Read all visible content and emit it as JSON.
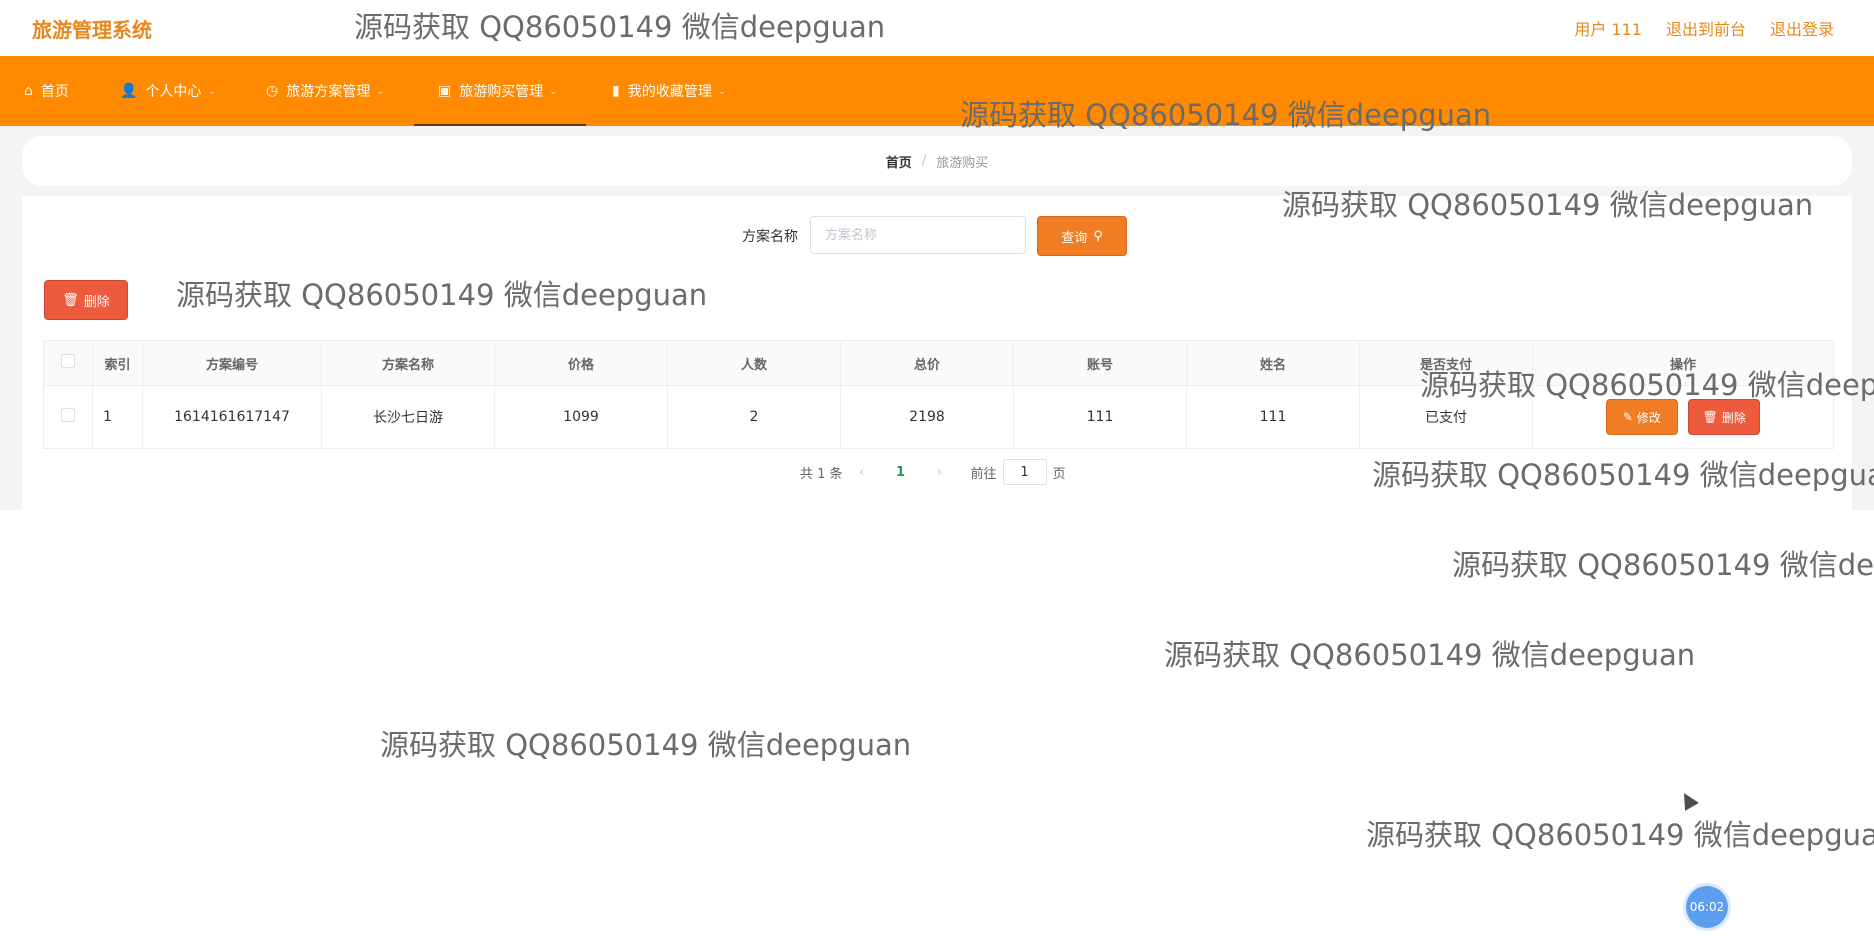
{
  "header": {
    "brand": "旅游管理系统",
    "user_label": "用户 111",
    "front_label": "退出到前台",
    "logout_label": "退出登录"
  },
  "nav": {
    "items": [
      {
        "label": "首页",
        "icon": "home-icon",
        "has_dropdown": false
      },
      {
        "label": "个人中心",
        "icon": "user-icon",
        "has_dropdown": true
      },
      {
        "label": "旅游方案管理",
        "icon": "clock-icon",
        "has_dropdown": true
      },
      {
        "label": "旅游购买管理",
        "icon": "shop-icon",
        "has_dropdown": true,
        "active": true
      },
      {
        "label": "我的收藏管理",
        "icon": "chart-icon",
        "has_dropdown": true
      }
    ]
  },
  "breadcrumb": {
    "home": "首页",
    "sep": "/",
    "current": "旅游购买"
  },
  "search": {
    "label": "方案名称",
    "placeholder": "方案名称",
    "value": "",
    "button_label": "查询"
  },
  "actions": {
    "delete_label": "删除"
  },
  "table": {
    "columns": [
      "索引",
      "方案编号",
      "方案名称",
      "价格",
      "人数",
      "总价",
      "账号",
      "姓名",
      "是否支付",
      "操作"
    ],
    "rows": [
      {
        "index": "1",
        "code": "1614161617147",
        "name": "长沙七日游",
        "price": "1099",
        "people": "2",
        "total": "2198",
        "account": "111",
        "realname": "111",
        "paid": "已支付"
      }
    ],
    "edit_label": "修改",
    "delete_label": "删除"
  },
  "pager": {
    "total_label": "共 1 条",
    "current": "1",
    "goto_label": "前往",
    "goto_value": "1",
    "page_suffix": "页"
  },
  "watermark": "源码获取 QQ86050149 微信deepguan",
  "clock": "06:02",
  "colors": {
    "accent": "#ff8a00",
    "brand": "#e8871e",
    "danger": "#ee5a3c",
    "primary": "#f07c24",
    "active_page": "#18a058"
  }
}
